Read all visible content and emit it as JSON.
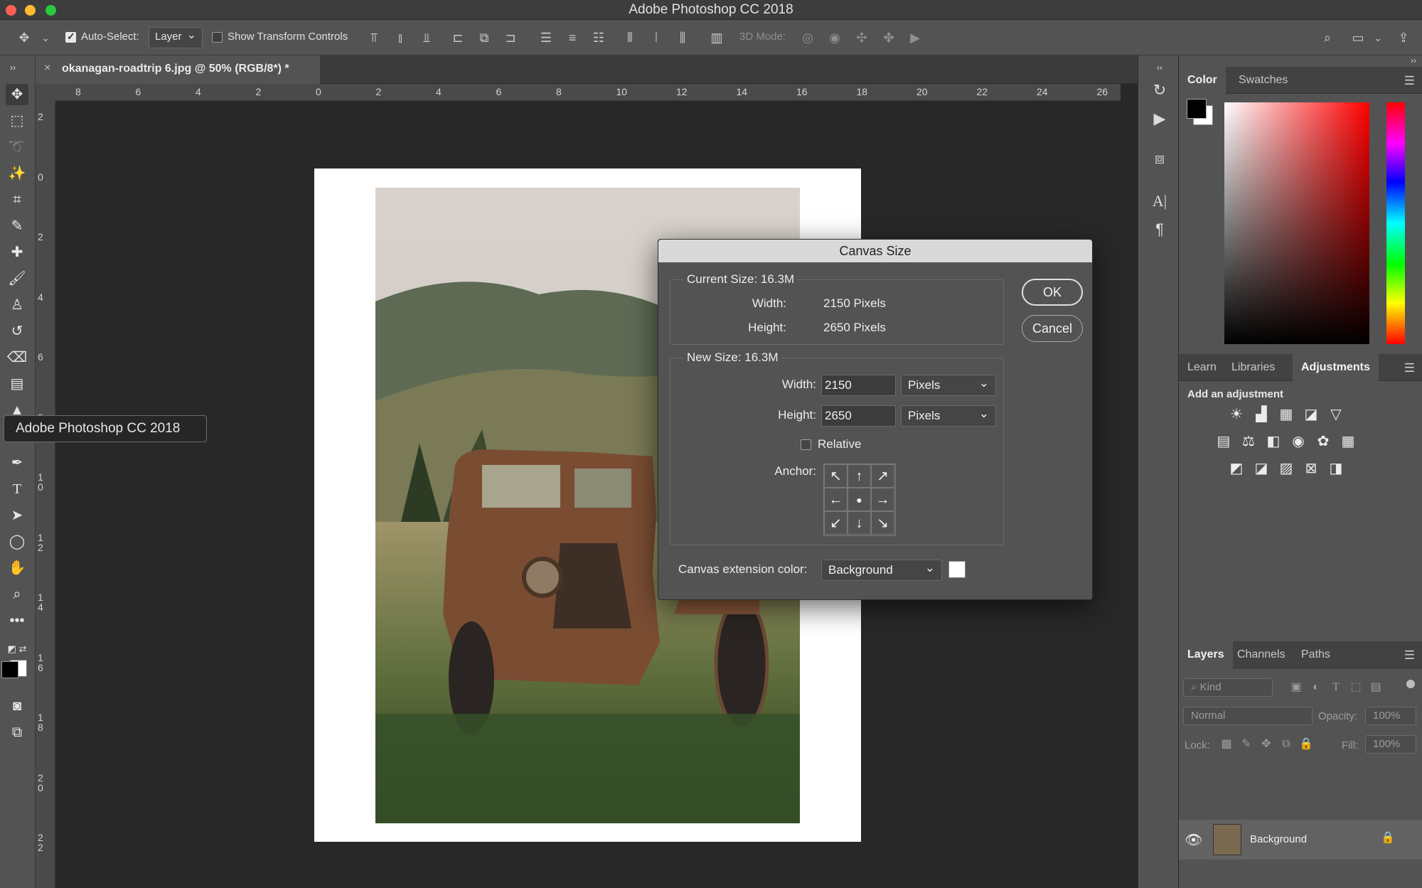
{
  "window": {
    "title": "Adobe Photoshop CC 2018"
  },
  "colors": {
    "close": "#ff5f57",
    "minimize": "#febc2e",
    "zoom": "#28c840",
    "ui": "#535353",
    "canvas": "#282828"
  },
  "options_bar": {
    "auto_select_label": "Auto-Select:",
    "auto_select_checked": true,
    "layer_select": "Layer",
    "show_transform_label": "Show Transform Controls",
    "three_d_mode_label": "3D Mode:"
  },
  "document_tab": {
    "label": "okanagan-roadtrip 6.jpg @ 50% (RGB/8*) *",
    "close": "×"
  },
  "ruler": {
    "top": [
      "8",
      "6",
      "4",
      "2",
      "0",
      "2",
      "4",
      "6",
      "8",
      "10",
      "12",
      "14",
      "16",
      "18",
      "20",
      "22",
      "24",
      "26"
    ],
    "left": [
      "2",
      "0",
      "2",
      "4",
      "6",
      "8",
      "10",
      "12",
      "14",
      "16",
      "18",
      "20",
      "22"
    ]
  },
  "tooltip": "Adobe Photoshop CC 2018",
  "dialog": {
    "title": "Canvas Size",
    "current_size_label": "Current Size: 16.3M",
    "current_width_label": "Width:",
    "current_width_value": "2150 Pixels",
    "current_height_label": "Height:",
    "current_height_value": "2650 Pixels",
    "new_size_label": "New Size: 16.3M",
    "width_label": "Width:",
    "width_value": "2150",
    "width_unit": "Pixels",
    "height_label": "Height:",
    "height_value": "2650",
    "height_unit": "Pixels",
    "relative_label": "Relative",
    "relative_checked": false,
    "anchor_label": "Anchor:",
    "extension_color_label": "Canvas extension color:",
    "extension_color_value": "Background",
    "extension_swatch": "#ffffff",
    "ok": "OK",
    "cancel": "Cancel"
  },
  "panels": {
    "color_tabs": [
      "Color",
      "Swatches"
    ],
    "adjust_tabs": [
      "Learn",
      "Libraries",
      "Adjustments"
    ],
    "add_adjustment": "Add an adjustment",
    "layers_tabs": [
      "Layers",
      "Channels",
      "Paths"
    ],
    "kind_filter": "Kind",
    "blend_mode": "Normal",
    "opacity_label": "Opacity:",
    "opacity_value": "100%",
    "lock_label": "Lock:",
    "fill_label": "Fill:",
    "fill_value": "100%",
    "layer_name": "Background"
  }
}
